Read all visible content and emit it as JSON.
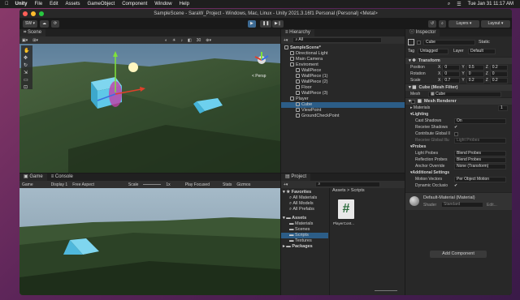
{
  "menubar": {
    "apple": "",
    "app": "Unity",
    "items": [
      "File",
      "Edit",
      "Assets",
      "GameObject",
      "Component",
      "Window",
      "Help"
    ],
    "datetime": "Tue Jan 31  11:17 AM"
  },
  "window": {
    "title": "SampleScene - SaraW_Project - Windows, Mac, Linux - Unity 2021.3.16f1 Personal (Personal) <Metal>"
  },
  "toolbar": {
    "account": "SW",
    "layers": "Layers",
    "layout": "Layout"
  },
  "scene": {
    "tab": "Scene",
    "persp": "< Persp",
    "scale_btn": "30"
  },
  "game": {
    "tab_game": "Game",
    "tab_console": "Console",
    "display_mode": "Game",
    "display": "Display 1",
    "aspect": "Free Aspect",
    "scale_label": "Scale",
    "scale_value": "1x",
    "play_mode": "Play Focused",
    "stats": "Stats",
    "gizmos": "Gizmos"
  },
  "hierarchy": {
    "tab": "Hierarchy",
    "search_placeholder": "All",
    "items": [
      {
        "label": "SampleScene*",
        "depth": 0,
        "selected": false,
        "bold": true
      },
      {
        "label": "Directional Light",
        "depth": 1
      },
      {
        "label": "Main Camera",
        "depth": 1
      },
      {
        "label": "Enviroment",
        "depth": 1
      },
      {
        "label": "WallPiece",
        "depth": 2
      },
      {
        "label": "WallPiece (1)",
        "depth": 2
      },
      {
        "label": "WallPiece (2)",
        "depth": 2
      },
      {
        "label": "Floor",
        "depth": 2
      },
      {
        "label": "WallPiece (3)",
        "depth": 2
      },
      {
        "label": "Player",
        "depth": 1
      },
      {
        "label": "Cube",
        "depth": 2,
        "selected": true
      },
      {
        "label": "ViewPoint",
        "depth": 2
      },
      {
        "label": "GroundCheckPoint",
        "depth": 2
      }
    ]
  },
  "project": {
    "tab": "Project",
    "favorites_label": "Favorites",
    "favorites": [
      "All Materials",
      "All Models",
      "All Prefabs"
    ],
    "assets_label": "Assets",
    "assets": [
      "Materials",
      "Scenes",
      "Scripts",
      "Textures"
    ],
    "packages_label": "Packages",
    "breadcrumb_root": "Assets",
    "breadcrumb_sep": ">",
    "breadcrumb_current": "Scripts",
    "file_name": "PlayerCont...",
    "file_glyph": "#"
  },
  "inspector": {
    "tab": "Inspector",
    "object_name": "Cube",
    "static_label": "Static",
    "tag_label": "Tag",
    "tag_value": "Untagged",
    "layer_label": "Layer",
    "layer_value": "Default",
    "transform": {
      "header": "Transform",
      "rows": [
        {
          "label": "Position",
          "x": "0",
          "y": "0.5",
          "z": "0.2"
        },
        {
          "label": "Rotation",
          "x": "0",
          "y": "0",
          "z": "0"
        },
        {
          "label": "Scale",
          "x": "0.7",
          "y": "0.2",
          "z": "0.2"
        }
      ]
    },
    "meshfilter": {
      "header": "Cube (Mesh Filter)",
      "mesh_label": "Mesh",
      "mesh_value": "Cube"
    },
    "meshrenderer": {
      "header": "Mesh Renderer",
      "materials": "Materials",
      "materials_count": "1",
      "lighting": "Lighting",
      "cast_shadows_label": "Cast Shadows",
      "cast_shadows_value": "On",
      "receive_shadows_label": "Receive Shadows",
      "contribute_gi_label": "Contribute Global Il",
      "receive_gi_label": "Receive Global Illu",
      "receive_gi_value": "Light Probes",
      "probes": "Probes",
      "light_probes_label": "Light Probes",
      "light_probes_value": "Blend Probes",
      "reflection_probes_label": "Reflection Probes",
      "reflection_probes_value": "Blend Probes",
      "anchor_label": "Anchor Override",
      "anchor_value": "None (Transform)",
      "additional": "Additional Settings",
      "motion_label": "Motion Vectors",
      "motion_value": "Per Object Motion",
      "dynamic_label": "Dynamic Occlusio"
    },
    "material": {
      "name": "Default-Material (Material)",
      "shader_label": "Shader",
      "shader_value": "Standard",
      "edit": "Edit..."
    },
    "add_component": "Add Component"
  },
  "colors": {
    "accent": "#2c5d87",
    "panel": "#282828",
    "dark": "#191919",
    "cube": "#5fc8e8"
  }
}
